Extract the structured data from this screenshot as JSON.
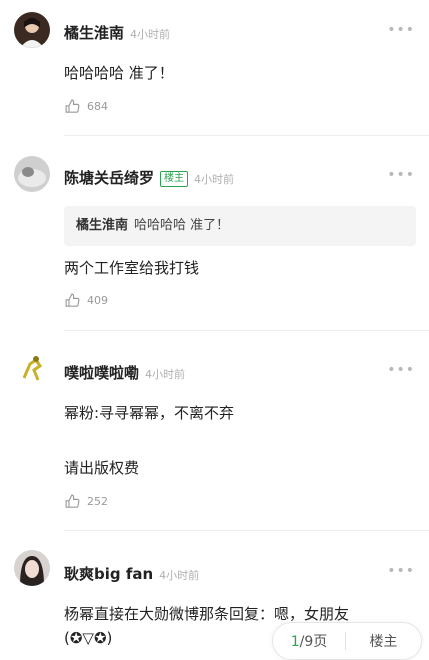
{
  "comments": [
    {
      "name": "橘生淮南",
      "time": "4小时前",
      "more": "•••",
      "text_lines": [
        "哈哈哈哈 准了！"
      ],
      "likes": "684"
    },
    {
      "name": "陈塘关岳绮罗",
      "badge": "楼主",
      "time": "4小时前",
      "more": "•••",
      "quote": {
        "name": "橘生淮南",
        "text": "哈哈哈哈 准了！"
      },
      "text_lines": [
        "两个工作室给我打钱"
      ],
      "likes": "409"
    },
    {
      "name": "噗啦噗啦嘞",
      "time": "4小时前",
      "more": "•••",
      "text_lines": [
        "幂粉:寻寻幂幂，不离不弃",
        "请出版权费"
      ],
      "likes": "252"
    },
    {
      "name": "耿爽big fan",
      "time": "4小时前",
      "more": "•••",
      "text_lines": [
        "杨幂直接在大勋微博那条回复：嗯，女朋友",
        "(✪▽✪)"
      ]
    }
  ],
  "pager": {
    "current": "1",
    "total_label": "/9页",
    "op_label": "楼主"
  },
  "colors": {
    "accent": "#2aa44f",
    "muted": "#b0b0b0"
  }
}
